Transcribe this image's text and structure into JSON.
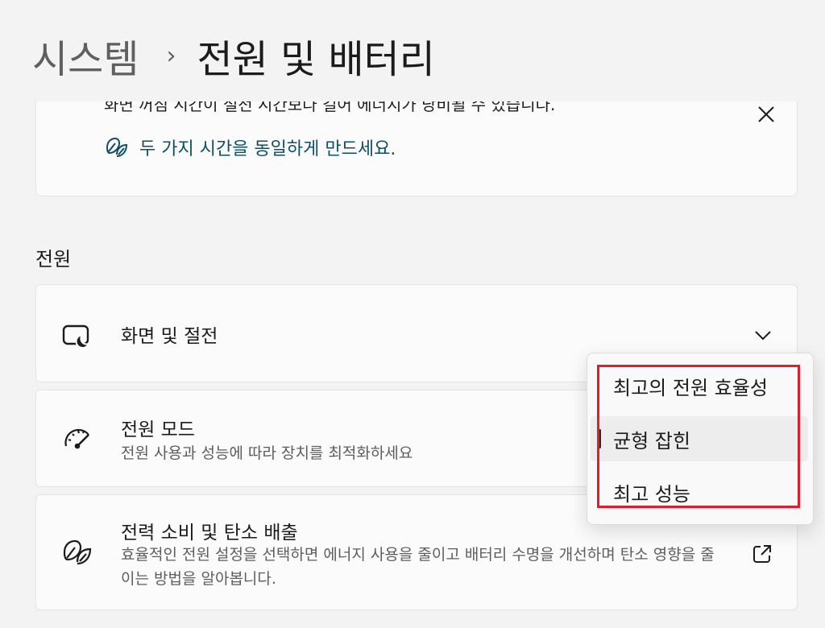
{
  "breadcrumb": {
    "parent": "시스템",
    "separator": "›",
    "current": "전원 및 배터리"
  },
  "notice": {
    "clipped_text": "화면 꺼짐 시간이 절전 시간보다 길어 에너지가 낭비될 수 있습니다.",
    "link_label": "두 가지 시간을 동일하게 만드세요.",
    "link_icon": "leaf-icon",
    "close_icon": "close-icon"
  },
  "power_section": {
    "label": "전원"
  },
  "cards": {
    "display_sleep": {
      "title": "화면 및 절전",
      "icon": "screen-sleep-icon",
      "chevron_icon": "chevron-down-icon"
    },
    "power_mode": {
      "title": "전원 모드",
      "description": "전원 사용과 성능에 따라 장치를 최적화하세요",
      "icon": "gauge-icon"
    },
    "energy": {
      "title": "전력 소비 및 탄소 배출",
      "description": "효율적인 전원 설정을 선택하면 에너지 사용을 줄이고 배터리 수명을 개선하며 탄소 영향을 줄이는 방법을 알아봅니다.",
      "icon": "leaf-icon",
      "external_icon": "external-link-icon"
    }
  },
  "power_mode_dropdown": {
    "options": [
      "최고의 전원 효율성",
      "균형 잡힌",
      "최고 성능"
    ],
    "selected_index": 1
  },
  "colors": {
    "background": "#f3f3f3",
    "card": "#fbfbfb",
    "link": "#0e4f63",
    "highlight": "#e01d2c"
  }
}
